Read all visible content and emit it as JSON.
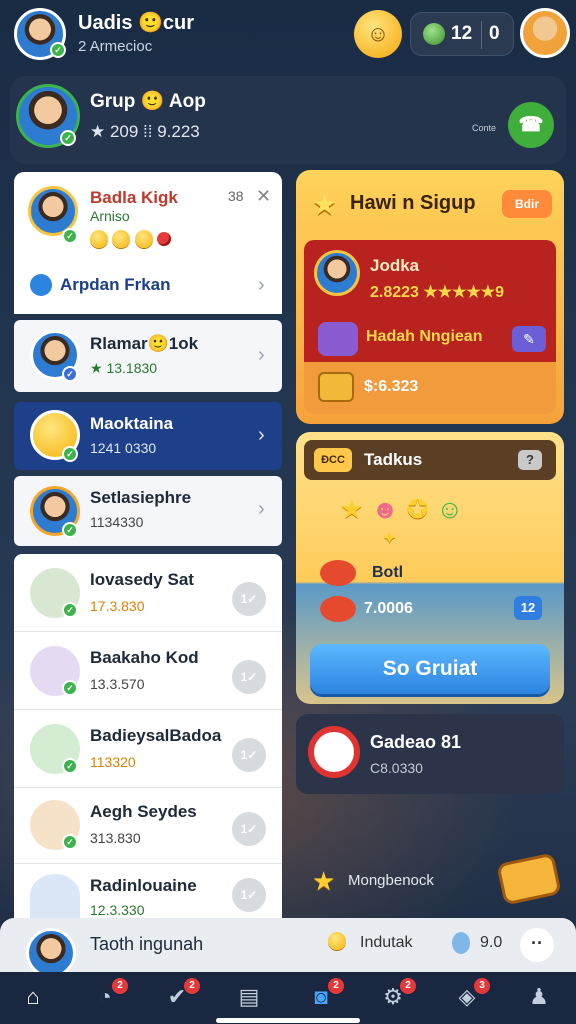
{
  "header": {
    "name": "Uadis 🙂cur",
    "subtitle": "2 Armecioc",
    "coins_a": "12",
    "coins_b": "0"
  },
  "group": {
    "title": "Grup 🙂 Aop",
    "stats": "★ 209   ⁞⁞ 9.223",
    "small": "Conte"
  },
  "left_list": [
    {
      "title": "Badla Kigk",
      "sub": "Arniso",
      "close": "38",
      "extra": "Arpdan Frkan"
    },
    {
      "title": "Rlamar🙂1ok",
      "sub": "★ 13.1830"
    },
    {
      "title": "Maoktaina",
      "sub": "1241 0330"
    },
    {
      "title": "Setlasiephre",
      "sub": "1134330"
    },
    {
      "title": "Iovasedy Sat",
      "sub": "17.3.830",
      "btn": "1✓"
    },
    {
      "title": "Baakaho Kod",
      "sub": "13.3.570",
      "btn": "1✓"
    },
    {
      "title": "BadieysalBadoa",
      "sub": "113320",
      "btn": "1✓"
    },
    {
      "title": "Aegh Seydes",
      "sub": "313.830",
      "btn": "1✓"
    },
    {
      "title": "Radinlouaine",
      "sub": "12.3.330",
      "btn": "1✓"
    }
  ],
  "promo": {
    "title": "Hawi n Sigup",
    "tag": "Bdir",
    "name": "Jodka",
    "score": "2.8223 ★★★★★9",
    "reward": "Hadah Nngiean",
    "bottom": "$:6.323"
  },
  "game": {
    "tag": "ĐCC",
    "title": "Tadkus",
    "help": "?",
    "bot_label": "Botl",
    "bot_value": "7.0006",
    "num": "12",
    "button": "So Gruiat"
  },
  "mini": {
    "title": "Gadeao 81",
    "sub": "C8.0330"
  },
  "message_line": "Mongbenock",
  "bottom_panel": {
    "name": "Taoth ingunah",
    "item1": "Indutak",
    "item2": "9.0",
    "more": "··"
  },
  "nav": {
    "badges": [
      "2",
      "2",
      "2",
      "2",
      "3"
    ]
  },
  "colors": {
    "bg": "#1a2b44",
    "accent_green": "#3fae3a",
    "accent_blue": "#2d83e0",
    "promo_red": "#b8221f"
  }
}
